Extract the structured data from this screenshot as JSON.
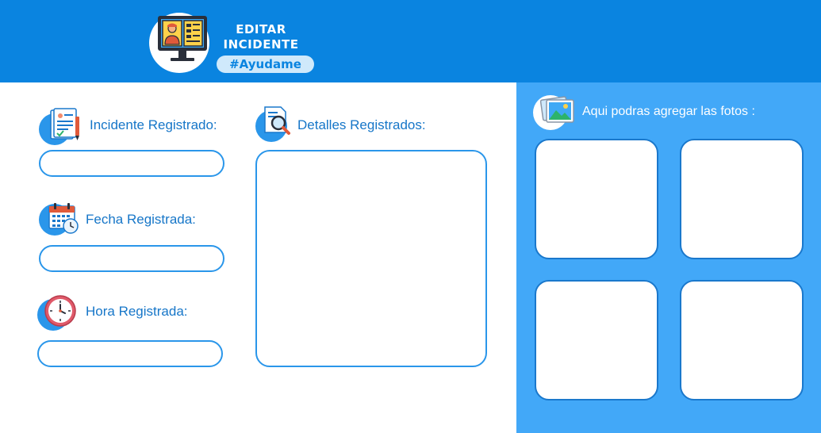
{
  "header": {
    "title_line1": "EDITAR",
    "title_line2": "INCIDENTE",
    "tag": "#Ayudame",
    "logo_icon": "computer-user-profile-icon"
  },
  "form": {
    "incidente": {
      "label": "Incidente Registrado:",
      "value": "",
      "icon": "clipboard-document-icon"
    },
    "fecha": {
      "label": "Fecha Registrada:",
      "value": "",
      "icon": "calendar-clock-icon"
    },
    "hora": {
      "label": "Hora Registrada:",
      "value": "",
      "icon": "clock-icon"
    },
    "detalles": {
      "label": "Detalles Registrados:",
      "value": "",
      "icon": "document-search-icon"
    }
  },
  "photos": {
    "label": "Aqui podras agregar las fotos :",
    "icon": "image-gallery-icon"
  },
  "colors": {
    "header_bg": "#0a84e0",
    "panel_bg": "#42a8f8",
    "accent": "#2a96ea",
    "label_text": "#1676c8"
  }
}
